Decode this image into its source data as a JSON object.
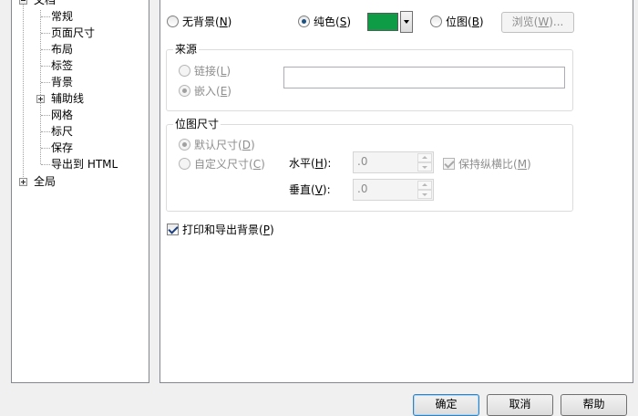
{
  "tree": {
    "items": [
      {
        "label": "文档",
        "expanded": true
      },
      {
        "label": "常规"
      },
      {
        "label": "页面尺寸"
      },
      {
        "label": "布局"
      },
      {
        "label": "标签"
      },
      {
        "label": "背景"
      },
      {
        "label": "辅助线",
        "expandable": true
      },
      {
        "label": "网格"
      },
      {
        "label": "标尺"
      },
      {
        "label": "保存"
      },
      {
        "label": "导出到 HTML"
      },
      {
        "label": "全局",
        "expandable": true
      }
    ]
  },
  "background": {
    "none_label_prefix": "无背景(",
    "none_label_key": "N",
    "none_label_suffix": ")",
    "solid_label_prefix": "纯色(",
    "solid_label_key": "S",
    "solid_label_suffix": ")",
    "bitmap_label_prefix": "位图(",
    "bitmap_label_key": "B",
    "bitmap_label_suffix": ")",
    "selected": "solid",
    "solid_color": "#0f9c47",
    "browse_label_prefix": "浏览(",
    "browse_label_key": "W",
    "browse_label_suffix": ")..."
  },
  "source": {
    "title": "来源",
    "link_prefix": "链接(",
    "link_key": "L",
    "link_suffix": ")",
    "embed_prefix": "嵌入(",
    "embed_key": "E",
    "embed_suffix": ")",
    "path_value": ""
  },
  "bitmap_size": {
    "title": "位图尺寸",
    "default_prefix": "默认尺寸(",
    "default_key": "D",
    "default_suffix": ")",
    "custom_prefix": "自定义尺寸(",
    "custom_key": "C",
    "custom_suffix": ")",
    "horizontal_prefix": "水平(",
    "horizontal_key": "H",
    "horizontal_suffix": "):",
    "horizontal_value": ".0",
    "vertical_prefix": "垂直(",
    "vertical_key": "V",
    "vertical_suffix": "):",
    "vertical_value": ".0",
    "keep_ratio_prefix": "保持纵横比(",
    "keep_ratio_key": "M",
    "keep_ratio_suffix": ")"
  },
  "print_export": {
    "label_prefix": "打印和导出背景(",
    "label_key": "P",
    "label_suffix": ")",
    "checked": true
  },
  "footer": {
    "ok": "确定",
    "cancel": "取消",
    "help": "帮助"
  }
}
